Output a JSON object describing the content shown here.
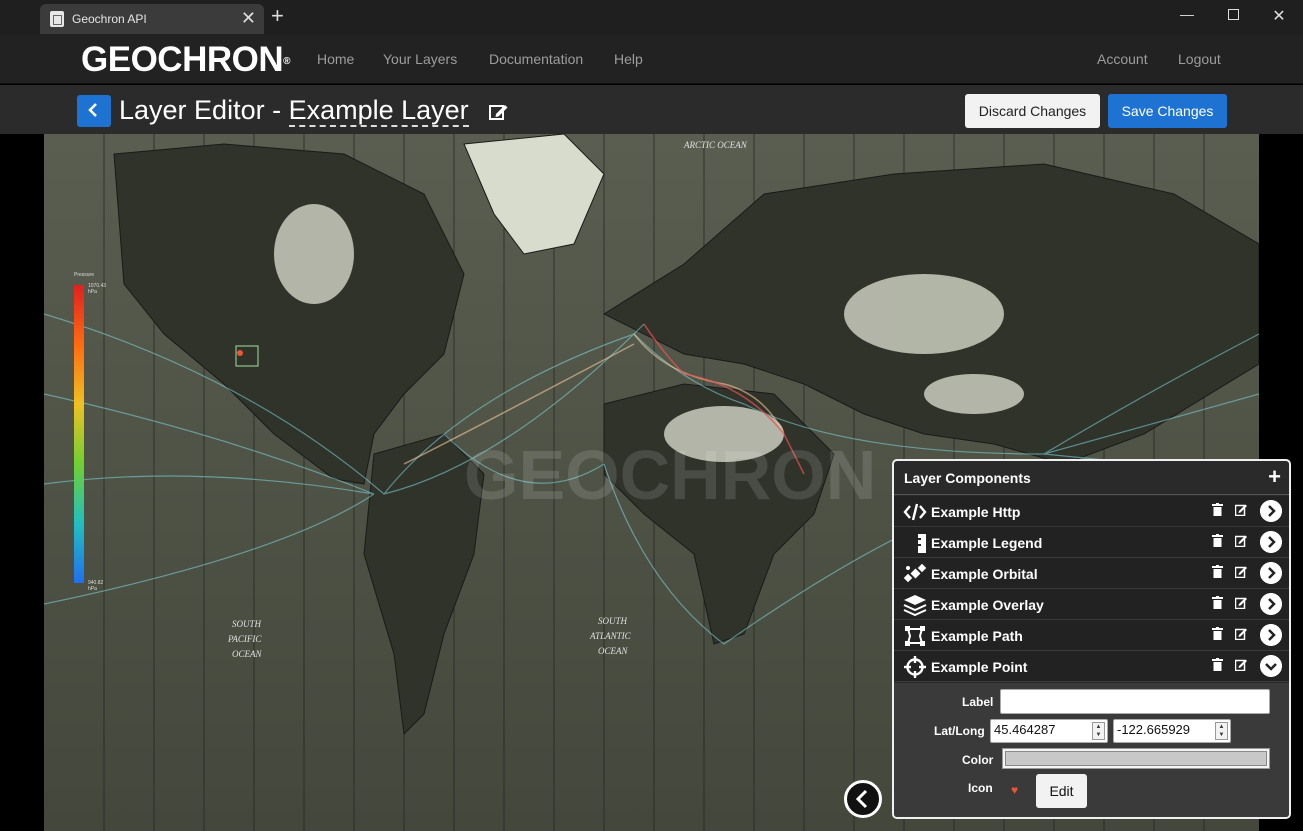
{
  "browser": {
    "tab_title": "Geochron API",
    "new_tab": "+",
    "close_tab": "✕"
  },
  "navbar": {
    "logo": "GEOCHRON",
    "logo_mark": "®",
    "links": [
      "Home",
      "Your Layers",
      "Documentation",
      "Help"
    ],
    "right_links": [
      "Account",
      "Logout"
    ]
  },
  "editor": {
    "title_prefix": "Layer Editor - ",
    "layer_name": "Example Layer",
    "discard_label": "Discard Changes",
    "save_label": "Save Changes"
  },
  "map": {
    "labels": {
      "arctic": "ARCTIC OCEAN",
      "south_pacific_1": "SOUTH",
      "south_pacific_2": "PACIFIC",
      "south_pacific_3": "OCEAN",
      "south_atlantic_1": "SOUTH",
      "south_atlantic_2": "ATLANTIC",
      "south_atlantic_3": "OCEAN"
    },
    "legend": {
      "title": "Pressure",
      "max": "1070.43 hPa",
      "min": "940.82 hPa"
    },
    "accent_colors": [
      "#e02020",
      "#ff6a10",
      "#f0c020",
      "#70d030",
      "#20c0c0",
      "#2070f0"
    ]
  },
  "panel": {
    "title": "Layer Components",
    "add_symbol": "+",
    "components": [
      {
        "label": "Example Http",
        "icon": "code-icon"
      },
      {
        "label": "Example Legend",
        "icon": "legend-icon"
      },
      {
        "label": "Example Orbital",
        "icon": "satellite-icon"
      },
      {
        "label": "Example Overlay",
        "icon": "layers-icon"
      },
      {
        "label": "Example Path",
        "icon": "path-icon"
      },
      {
        "label": "Example Point",
        "icon": "crosshair-icon"
      }
    ],
    "point": {
      "label_label": "Label",
      "label_value": "",
      "latlong_label": "Lat/Long",
      "lat": "45.464287",
      "lng": "-122.665929",
      "color_label": "Color",
      "color_value": "#c8c8c8",
      "icon_label": "Icon",
      "icon_symbol": "♥",
      "icon_edit": "Edit"
    }
  }
}
